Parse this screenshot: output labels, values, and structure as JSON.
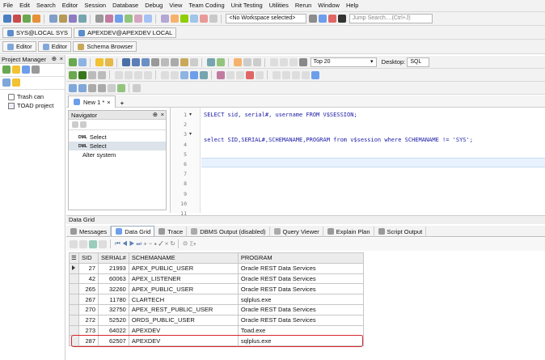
{
  "menu": [
    "File",
    "Edit",
    "Search",
    "Editor",
    "Session",
    "Database",
    "Debug",
    "View",
    "Team Coding",
    "Unit Testing",
    "Utilities",
    "Rerun",
    "Window",
    "Help"
  ],
  "workspace_select": "<No Workspace selected>",
  "jump_search_placeholder": "Jump Search....(Ctrl+J)",
  "connections": [
    "SYS@LOCAL SYS",
    "APEXDEV@APEXDEV LOCAL"
  ],
  "view_buttons": [
    "Editor",
    "Editor",
    "Schema Browser"
  ],
  "project_manager": {
    "title": "Project Manager",
    "items": [
      "Trash can",
      "TOAD project"
    ]
  },
  "toolbar": {
    "top_value": "Top 20",
    "desktop_label": "Desktop:",
    "desktop_value": "SQL"
  },
  "editor": {
    "tab": "New 1 *",
    "line_numbers": [
      "1",
      "2",
      "3",
      "4",
      "5",
      "6",
      "7",
      "8",
      "9",
      "10",
      "11"
    ],
    "line1": "SELECT sid, serial#, username FROM V$SESSION;",
    "line3": "select SID,SERIAL#,SCHEMANAME,PROGRAM from v$session where SCHEMANAME != 'SYS';"
  },
  "navigator": {
    "title": "Navigator",
    "items": [
      {
        "badge": "DML",
        "label": "Select"
      },
      {
        "badge": "DML",
        "label": "Select"
      },
      {
        "badge": "",
        "label": "Alter system"
      }
    ]
  },
  "data_grid": {
    "title": "Data Grid",
    "tabs": [
      "Messages",
      "Data Grid",
      "Trace",
      "DBMS Output (disabled)",
      "Query Viewer",
      "Explain Plan",
      "Script Output"
    ],
    "sigma": "Σ",
    "columns": [
      "SID",
      "SERIAL#",
      "SCHEMANAME",
      "PROGRAM"
    ],
    "rows": [
      [
        "27",
        "21993",
        "APEX_PUBLIC_USER",
        "Oracle REST Data Services"
      ],
      [
        "42",
        "60063",
        "APEX_LISTENER",
        "Oracle REST Data Services"
      ],
      [
        "265",
        "32260",
        "APEX_PUBLIC_USER",
        "Oracle REST Data Services"
      ],
      [
        "267",
        "11780",
        "CLARTECH",
        "sqlplus.exe"
      ],
      [
        "270",
        "32750",
        "APEX_REST_PUBLIC_USER",
        "Oracle REST Data Services"
      ],
      [
        "272",
        "52520",
        "ORDS_PUBLIC_USER",
        "Oracle REST Data Services"
      ],
      [
        "273",
        "64022",
        "APEXDEV",
        "Toad.exe"
      ],
      [
        "287",
        "62507",
        "APEXDEV",
        "sqlplus.exe"
      ]
    ],
    "highlight_color": "#d9262e"
  }
}
